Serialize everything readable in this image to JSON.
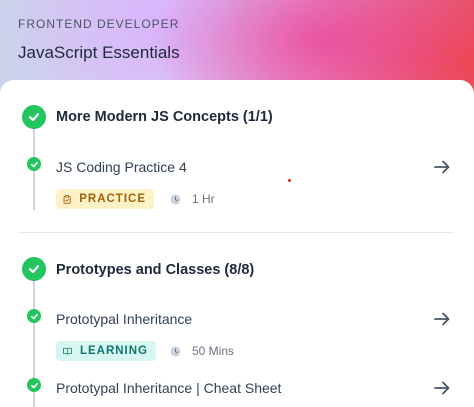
{
  "header": {
    "eyebrow": "FRONTEND DEVELOPER",
    "title": "JavaScript Essentials"
  },
  "sections": [
    {
      "title": "More Modern JS Concepts (1/1)",
      "items": [
        {
          "title": "JS Coding Practice 4",
          "badge": "PRACTICE",
          "duration": "1 Hr"
        }
      ]
    },
    {
      "title": "Prototypes and Classes (8/8)",
      "items": [
        {
          "title": "Prototypal Inheritance",
          "badge": "LEARNING",
          "duration": "50 Mins"
        },
        {
          "title": "Prototypal Inheritance | Cheat Sheet"
        }
      ]
    }
  ],
  "colors": {
    "complete": "#22c55e",
    "practice_badge_bg": "#fdf1c7",
    "practice_badge_text": "#a16207",
    "learning_badge_bg": "#d7f5f1",
    "learning_badge_text": "#0f766e"
  },
  "icons": {
    "section_status": "check-circle-icon",
    "item_status": "check-circle-icon",
    "open_item": "arrow-right-icon",
    "practice": "clipboard-icon",
    "learning": "book-open-icon",
    "duration": "clock-icon"
  }
}
